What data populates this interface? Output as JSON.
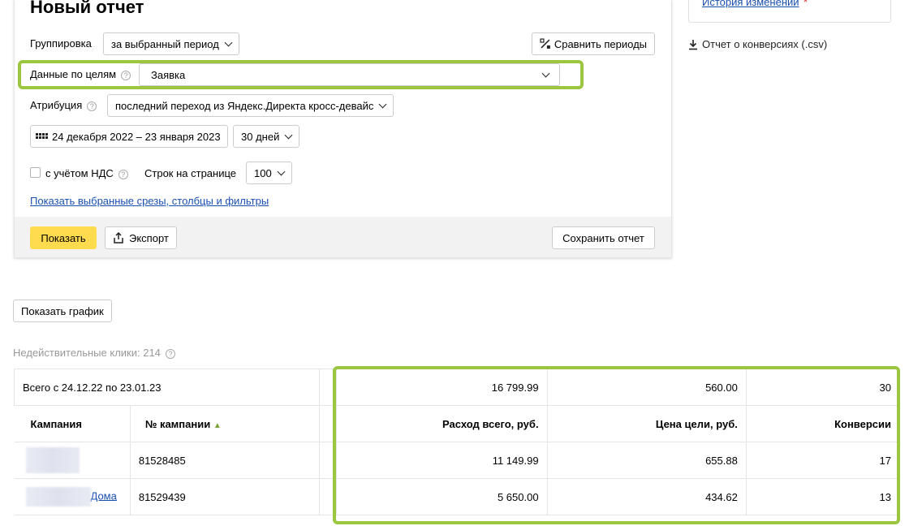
{
  "page": {
    "title": "Новый отчет"
  },
  "sidebar": {
    "history_label": "История изменений",
    "history_mark": "*",
    "csv_label": "Отчет о конверсиях (.csv)"
  },
  "filters": {
    "grouping_label": "Группировка",
    "grouping_value": "за выбранный период",
    "compare_label": "Сравнить периоды",
    "goals_label": "Данные по целям",
    "goals_value": "Заявка",
    "attribution_label": "Атрибуция",
    "attribution_value": "последний переход из Яндекс.Директа кросс-девайс",
    "date_range": "24 декабря 2022 – 23 января 2023",
    "period_value": "30 дней",
    "vat_label": "с учётом НДС",
    "rows_label": "Строк на странице",
    "rows_value": "100",
    "show_slices_link": "Показать выбранные срезы, столбцы и фильтры"
  },
  "actions": {
    "show_label": "Показать",
    "export_label": "Экспорт",
    "save_label": "Сохранить отчет",
    "show_chart_label": "Показать график"
  },
  "invalid_clicks": "Недействительные клики: 214",
  "table": {
    "total_label": "Всего с 24.12.22 по 23.01.23",
    "totals": [
      "16 799.99",
      "560.00",
      "30"
    ],
    "headers": {
      "campaign": "Кампания",
      "campaign_no": "№ кампании",
      "sort_indicator": "▲",
      "spend": "Расход всего, руб.",
      "goal_price": "Цена цели, руб.",
      "conversions": "Конверсии"
    },
    "rows": [
      {
        "name": "",
        "number": "81528485",
        "spend": "11 149.99",
        "goal_price": "655.88",
        "conversions": "17"
      },
      {
        "name": "Дома",
        "number": "81529439",
        "spend": "5 650.00",
        "goal_price": "434.62",
        "conversions": "13"
      }
    ]
  },
  "colors": {
    "accent_yellow": "#ffdb4d",
    "highlight_green": "#9bc63f",
    "link_blue": "#1a50b0"
  }
}
